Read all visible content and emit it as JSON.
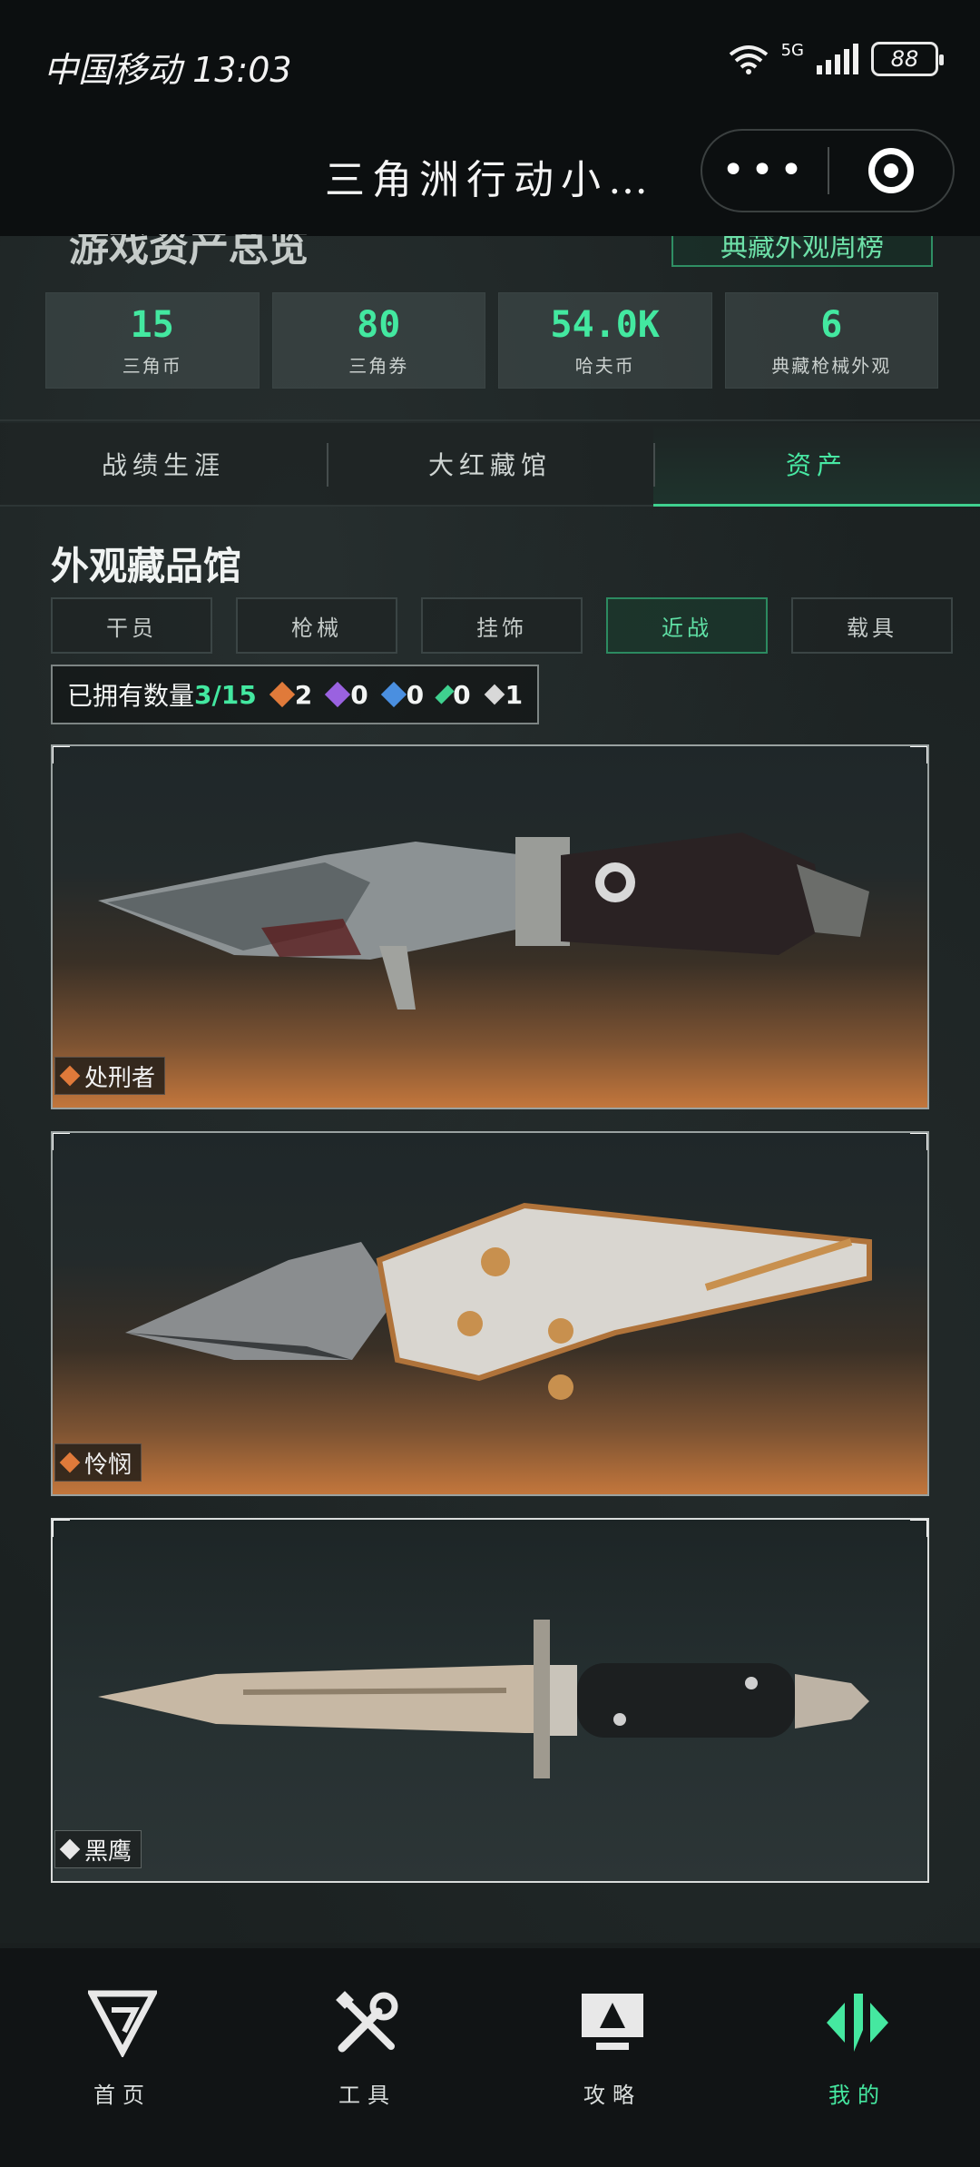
{
  "status": {
    "carrier_time": "中国移动 13:03",
    "signal": "5G",
    "battery": "88"
  },
  "titlebar": {
    "title": "三角洲行动小…"
  },
  "summary": {
    "title": "游戏资产总览",
    "rank_button": "典藏外观周榜",
    "stats": [
      {
        "value": "15",
        "label": "三角币"
      },
      {
        "value": "80",
        "label": "三角券"
      },
      {
        "value": "54.0K",
        "label": "哈夫币"
      },
      {
        "value": "6",
        "label": "典藏枪械外观"
      }
    ]
  },
  "tabs": [
    {
      "label": "战绩生涯",
      "active": false
    },
    {
      "label": "大红藏馆",
      "active": false
    },
    {
      "label": "资产",
      "active": true
    }
  ],
  "collection": {
    "title": "外观藏品馆",
    "sub_tabs": [
      {
        "label": "干员",
        "active": false
      },
      {
        "label": "枪械",
        "active": false
      },
      {
        "label": "挂饰",
        "active": false
      },
      {
        "label": "近战",
        "active": true
      },
      {
        "label": "载具",
        "active": false
      }
    ],
    "owned_label": "已拥有数量",
    "owned_count": "3/15",
    "rarity_counts": [
      {
        "color": "#e07a3a",
        "count": "2"
      },
      {
        "color": "#9a62e0",
        "count": "0"
      },
      {
        "color": "#4a8fe0",
        "count": "0"
      },
      {
        "color": "#3fd18f",
        "count": "0"
      },
      {
        "color": "#d8d8d8",
        "count": "1"
      }
    ],
    "items": [
      {
        "name": "处刑者",
        "rarity_color": "#e07a3a"
      },
      {
        "name": "怜悯",
        "rarity_color": "#e07a3a"
      },
      {
        "name": "黑鹰",
        "rarity_color": "#e8e8e8"
      }
    ]
  },
  "nav": [
    {
      "label": "首页",
      "icon": "home-logo-icon",
      "active": false
    },
    {
      "label": "工具",
      "icon": "tools-icon",
      "active": false
    },
    {
      "label": "攻略",
      "icon": "guide-monitor-icon",
      "active": false
    },
    {
      "label": "我的",
      "icon": "profile-logo-icon",
      "active": true
    }
  ],
  "colors": {
    "accent": "#43e8a0",
    "orange": "#e07a3a"
  }
}
